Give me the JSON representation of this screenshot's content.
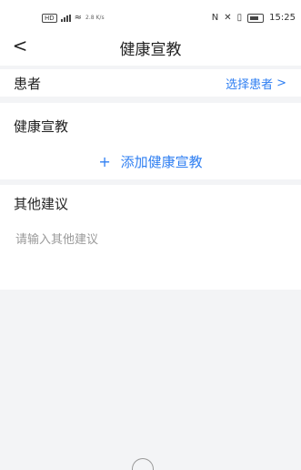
{
  "status_bar": {
    "net_speed": "2.8\nK/s",
    "time": "15:25"
  },
  "nav": {
    "back_icon": "<",
    "title": "健康宣教"
  },
  "patient": {
    "label": "患者",
    "action": "选择患者",
    "action_icon": ">"
  },
  "health_education": {
    "label": "健康宣教",
    "add_icon": "+",
    "add_label": "添加健康宣教"
  },
  "other_advice": {
    "label": "其他建议",
    "placeholder": "请输入其他建议",
    "value": ""
  },
  "colors": {
    "accent": "#2f7ff2",
    "background": "#f3f4f6",
    "card": "#ffffff"
  }
}
